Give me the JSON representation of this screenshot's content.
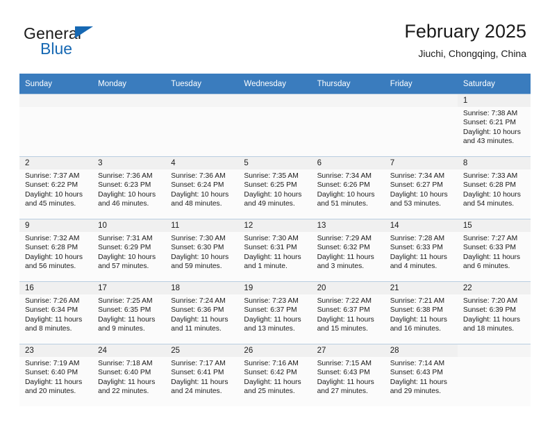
{
  "brand": {
    "word1": "General",
    "word2": "Blue",
    "accent_color": "#1668b3",
    "logo_icon": "triangle-flag-icon"
  },
  "header": {
    "title": "February 2025",
    "location": "Jiuchi, Chongqing, China"
  },
  "calendar": {
    "header_bg": "#3a7cbe",
    "weekdays": [
      "Sunday",
      "Monday",
      "Tuesday",
      "Wednesday",
      "Thursday",
      "Friday",
      "Saturday"
    ],
    "labels": {
      "sunrise": "Sunrise:",
      "sunset": "Sunset:",
      "daylight": "Daylight:"
    },
    "weeks": [
      [
        {
          "day": "",
          "empty": true
        },
        {
          "day": "",
          "empty": true
        },
        {
          "day": "",
          "empty": true
        },
        {
          "day": "",
          "empty": true
        },
        {
          "day": "",
          "empty": true
        },
        {
          "day": "",
          "empty": true
        },
        {
          "day": "1",
          "sunrise": "Sunrise: 7:38 AM",
          "sunset": "Sunset: 6:21 PM",
          "daylight": "Daylight: 10 hours and 43 minutes."
        }
      ],
      [
        {
          "day": "2",
          "sunrise": "Sunrise: 7:37 AM",
          "sunset": "Sunset: 6:22 PM",
          "daylight": "Daylight: 10 hours and 45 minutes."
        },
        {
          "day": "3",
          "sunrise": "Sunrise: 7:36 AM",
          "sunset": "Sunset: 6:23 PM",
          "daylight": "Daylight: 10 hours and 46 minutes."
        },
        {
          "day": "4",
          "sunrise": "Sunrise: 7:36 AM",
          "sunset": "Sunset: 6:24 PM",
          "daylight": "Daylight: 10 hours and 48 minutes."
        },
        {
          "day": "5",
          "sunrise": "Sunrise: 7:35 AM",
          "sunset": "Sunset: 6:25 PM",
          "daylight": "Daylight: 10 hours and 49 minutes."
        },
        {
          "day": "6",
          "sunrise": "Sunrise: 7:34 AM",
          "sunset": "Sunset: 6:26 PM",
          "daylight": "Daylight: 10 hours and 51 minutes."
        },
        {
          "day": "7",
          "sunrise": "Sunrise: 7:34 AM",
          "sunset": "Sunset: 6:27 PM",
          "daylight": "Daylight: 10 hours and 53 minutes."
        },
        {
          "day": "8",
          "sunrise": "Sunrise: 7:33 AM",
          "sunset": "Sunset: 6:28 PM",
          "daylight": "Daylight: 10 hours and 54 minutes."
        }
      ],
      [
        {
          "day": "9",
          "sunrise": "Sunrise: 7:32 AM",
          "sunset": "Sunset: 6:28 PM",
          "daylight": "Daylight: 10 hours and 56 minutes."
        },
        {
          "day": "10",
          "sunrise": "Sunrise: 7:31 AM",
          "sunset": "Sunset: 6:29 PM",
          "daylight": "Daylight: 10 hours and 57 minutes."
        },
        {
          "day": "11",
          "sunrise": "Sunrise: 7:30 AM",
          "sunset": "Sunset: 6:30 PM",
          "daylight": "Daylight: 10 hours and 59 minutes."
        },
        {
          "day": "12",
          "sunrise": "Sunrise: 7:30 AM",
          "sunset": "Sunset: 6:31 PM",
          "daylight": "Daylight: 11 hours and 1 minute."
        },
        {
          "day": "13",
          "sunrise": "Sunrise: 7:29 AM",
          "sunset": "Sunset: 6:32 PM",
          "daylight": "Daylight: 11 hours and 3 minutes."
        },
        {
          "day": "14",
          "sunrise": "Sunrise: 7:28 AM",
          "sunset": "Sunset: 6:33 PM",
          "daylight": "Daylight: 11 hours and 4 minutes."
        },
        {
          "day": "15",
          "sunrise": "Sunrise: 7:27 AM",
          "sunset": "Sunset: 6:33 PM",
          "daylight": "Daylight: 11 hours and 6 minutes."
        }
      ],
      [
        {
          "day": "16",
          "sunrise": "Sunrise: 7:26 AM",
          "sunset": "Sunset: 6:34 PM",
          "daylight": "Daylight: 11 hours and 8 minutes."
        },
        {
          "day": "17",
          "sunrise": "Sunrise: 7:25 AM",
          "sunset": "Sunset: 6:35 PM",
          "daylight": "Daylight: 11 hours and 9 minutes."
        },
        {
          "day": "18",
          "sunrise": "Sunrise: 7:24 AM",
          "sunset": "Sunset: 6:36 PM",
          "daylight": "Daylight: 11 hours and 11 minutes."
        },
        {
          "day": "19",
          "sunrise": "Sunrise: 7:23 AM",
          "sunset": "Sunset: 6:37 PM",
          "daylight": "Daylight: 11 hours and 13 minutes."
        },
        {
          "day": "20",
          "sunrise": "Sunrise: 7:22 AM",
          "sunset": "Sunset: 6:37 PM",
          "daylight": "Daylight: 11 hours and 15 minutes."
        },
        {
          "day": "21",
          "sunrise": "Sunrise: 7:21 AM",
          "sunset": "Sunset: 6:38 PM",
          "daylight": "Daylight: 11 hours and 16 minutes."
        },
        {
          "day": "22",
          "sunrise": "Sunrise: 7:20 AM",
          "sunset": "Sunset: 6:39 PM",
          "daylight": "Daylight: 11 hours and 18 minutes."
        }
      ],
      [
        {
          "day": "23",
          "sunrise": "Sunrise: 7:19 AM",
          "sunset": "Sunset: 6:40 PM",
          "daylight": "Daylight: 11 hours and 20 minutes."
        },
        {
          "day": "24",
          "sunrise": "Sunrise: 7:18 AM",
          "sunset": "Sunset: 6:40 PM",
          "daylight": "Daylight: 11 hours and 22 minutes."
        },
        {
          "day": "25",
          "sunrise": "Sunrise: 7:17 AM",
          "sunset": "Sunset: 6:41 PM",
          "daylight": "Daylight: 11 hours and 24 minutes."
        },
        {
          "day": "26",
          "sunrise": "Sunrise: 7:16 AM",
          "sunset": "Sunset: 6:42 PM",
          "daylight": "Daylight: 11 hours and 25 minutes."
        },
        {
          "day": "27",
          "sunrise": "Sunrise: 7:15 AM",
          "sunset": "Sunset: 6:43 PM",
          "daylight": "Daylight: 11 hours and 27 minutes."
        },
        {
          "day": "28",
          "sunrise": "Sunrise: 7:14 AM",
          "sunset": "Sunset: 6:43 PM",
          "daylight": "Daylight: 11 hours and 29 minutes."
        },
        {
          "day": "",
          "empty": true
        }
      ]
    ]
  }
}
